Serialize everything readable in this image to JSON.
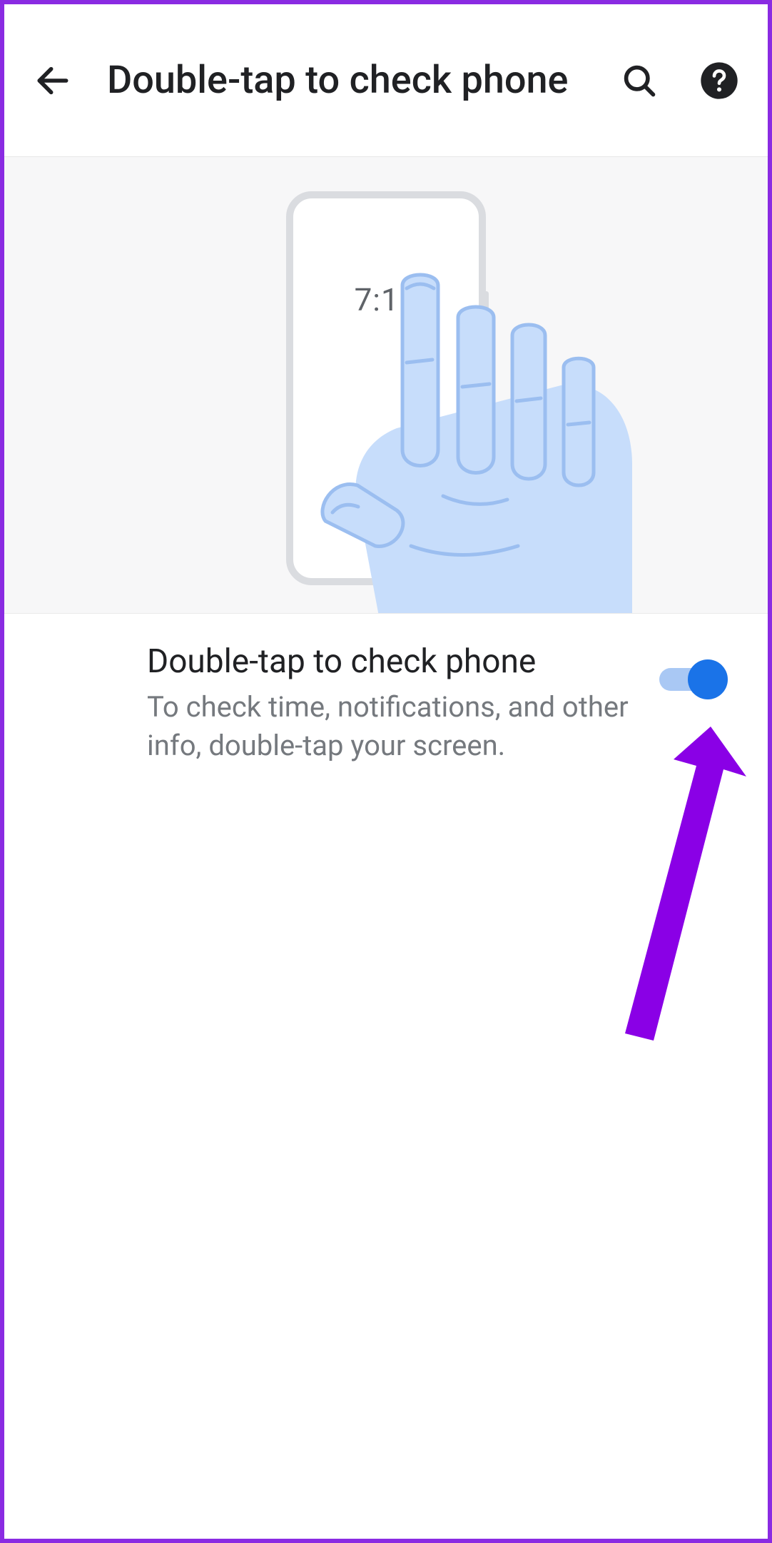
{
  "header": {
    "title": "Double-tap to check phone"
  },
  "hero": {
    "time": "7:15"
  },
  "setting": {
    "title": "Double-tap to check phone",
    "description": "To check time, notifications, and other info, double-tap your screen.",
    "enabled": true
  }
}
